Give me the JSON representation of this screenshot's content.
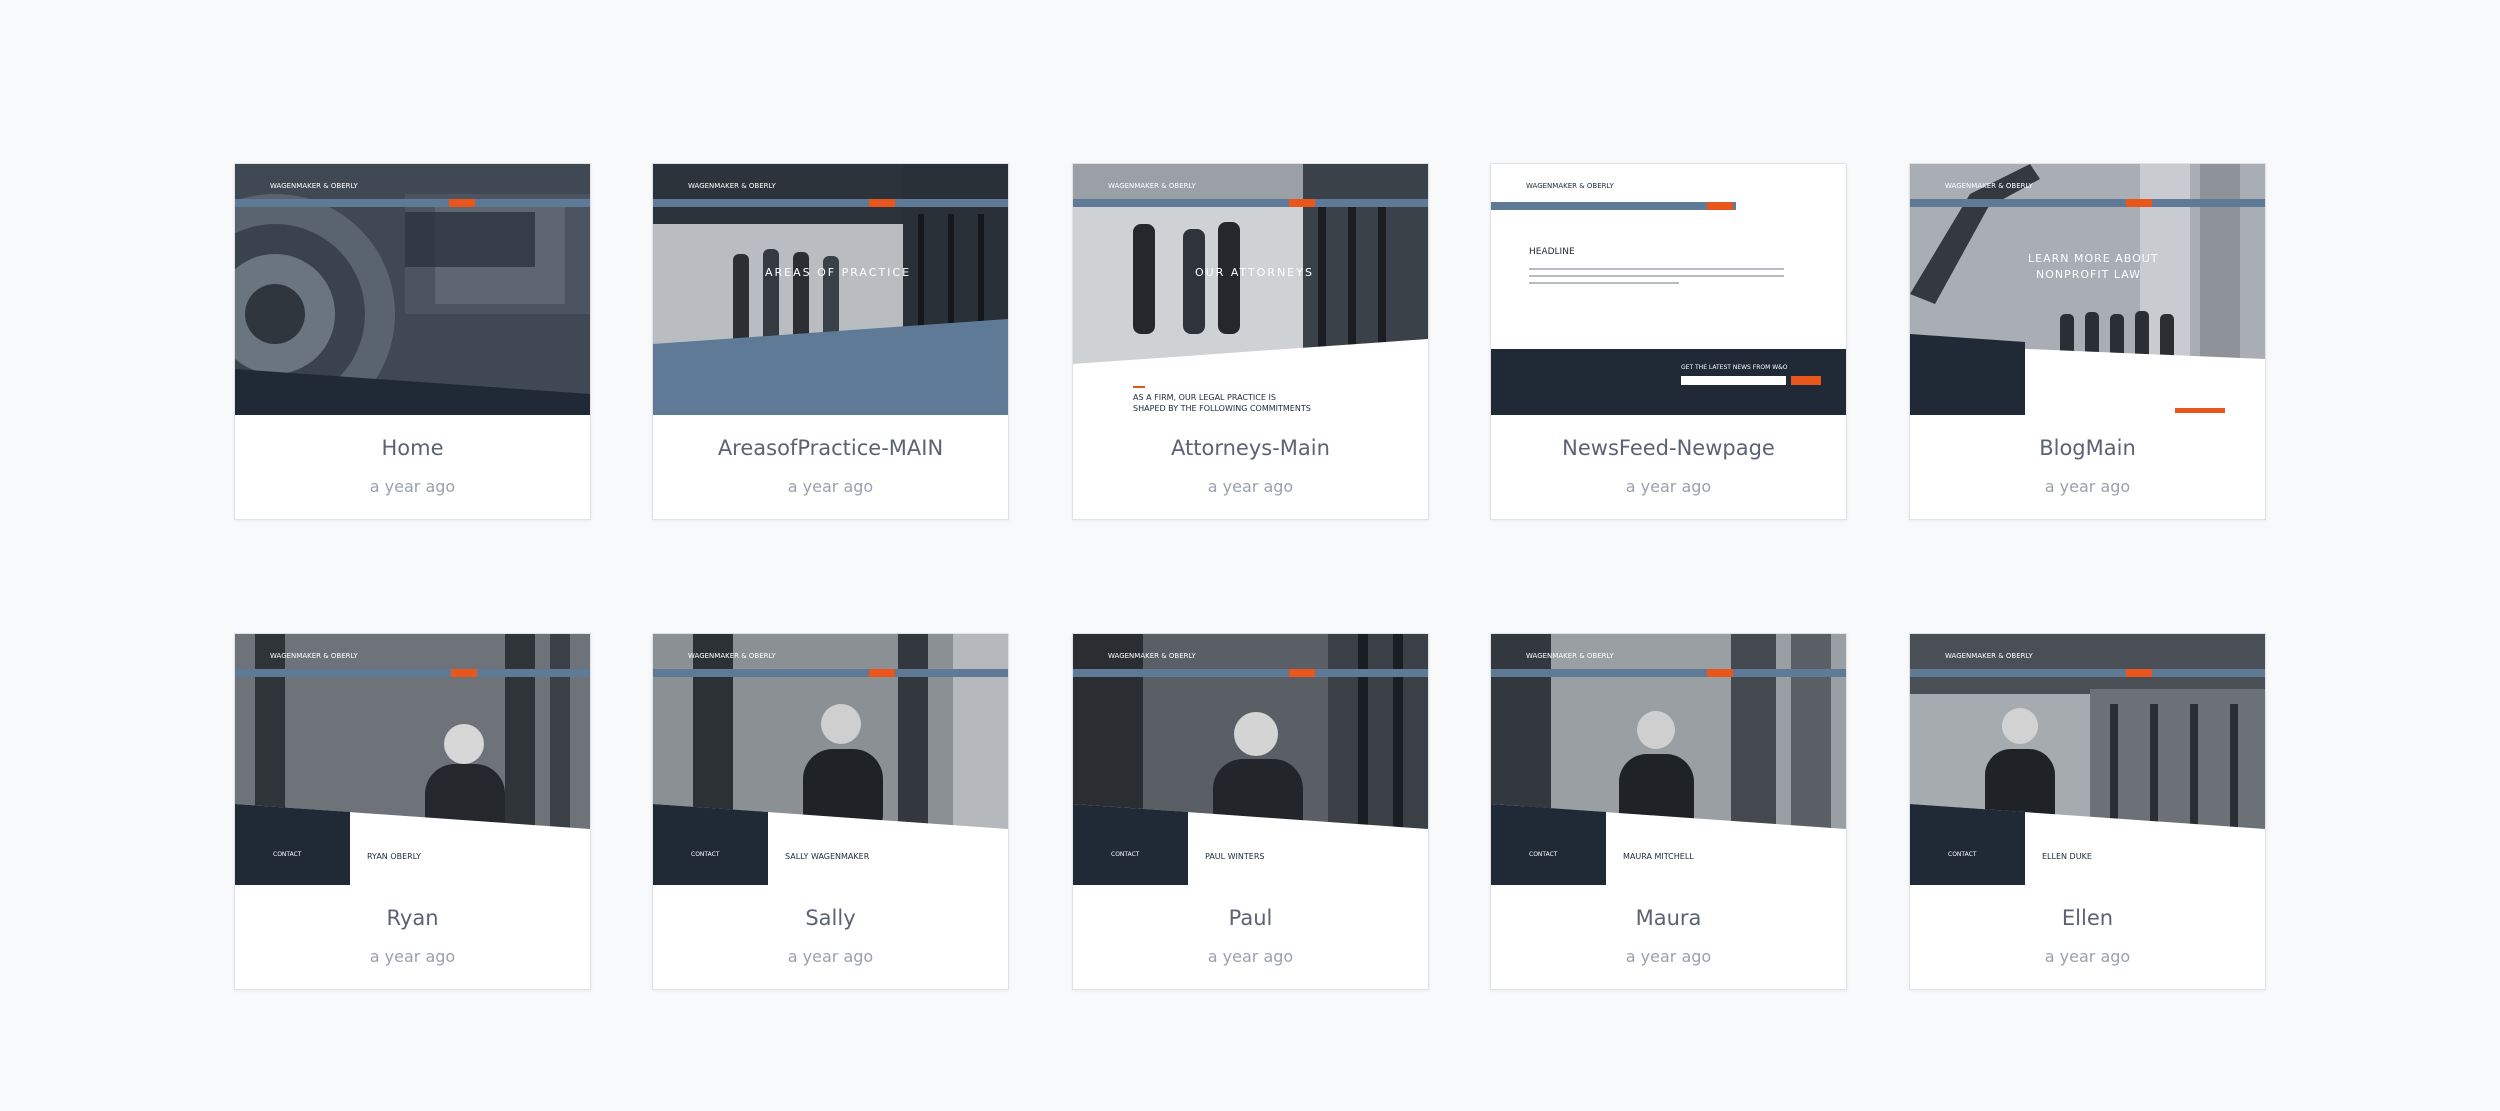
{
  "colors": {
    "background": "#f8f9fb",
    "navy": "#1f2a36",
    "slate": "#5e7a96",
    "orange": "#e8561c",
    "title_text": "#5b6372",
    "time_text": "#9aa1ac"
  },
  "thumb_text": {
    "brand": "WAGENMAKER & OBERLY",
    "areas": "AREAS OF PRACTICE",
    "attorneys": "OUR ATTORNEYS",
    "commit_1": "AS A FIRM, OUR LEGAL PRACTICE IS",
    "commit_2": "SHAPED BY THE FOLLOWING COMMITMENTS",
    "headline": "HEADLINE",
    "news": "GET THE LATEST NEWS FROM W&O",
    "blog_1": "LEARN MORE ABOUT",
    "blog_2": "NONPROFIT LAW",
    "contact": "CONTACT",
    "ryan": "RYAN OBERLY",
    "sally": "SALLY WAGENMAKER",
    "paul": "PAUL WINTERS",
    "maura": "MAURA MITCHELL",
    "ellen": "ELLEN DUKE"
  },
  "cards": [
    {
      "title": "Home",
      "time": "a year ago"
    },
    {
      "title": "AreasofPractice-MAIN",
      "time": "a year ago"
    },
    {
      "title": "Attorneys-Main",
      "time": "a year ago"
    },
    {
      "title": "NewsFeed-Newpage",
      "time": "a year ago"
    },
    {
      "title": "BlogMain",
      "time": "a year ago"
    },
    {
      "title": "Ryan",
      "time": "a year ago"
    },
    {
      "title": "Sally",
      "time": "a year ago"
    },
    {
      "title": "Paul",
      "time": "a year ago"
    },
    {
      "title": "Maura",
      "time": "a year ago"
    },
    {
      "title": "Ellen",
      "time": "a year ago"
    }
  ]
}
